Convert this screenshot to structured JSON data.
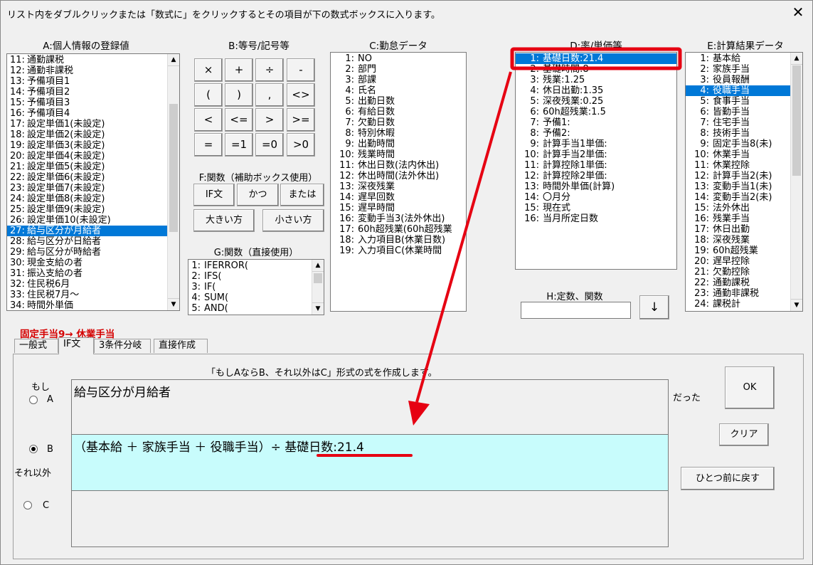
{
  "title": "リスト内をダブルクリックまたは「数式に」をクリックするとその項目が下の数式ボックスに入ります。",
  "close_glyph": "✕",
  "sections": {
    "a": "A:個人情報の登録値",
    "b": "B:等号/記号等",
    "c": "C:勤怠データ",
    "d": "D:率/単価等",
    "e": "E:計算結果データ",
    "f": "F:関数（補助ボックス使用）",
    "g": "G:関数（直接使用）",
    "h": "H:定数、関数"
  },
  "list_a": [
    {
      "n": "11:",
      "t": "通勤課税"
    },
    {
      "n": "12:",
      "t": "通勤非課税"
    },
    {
      "n": "13:",
      "t": "予備項目1"
    },
    {
      "n": "14:",
      "t": "予備項目2"
    },
    {
      "n": "15:",
      "t": "予備項目3"
    },
    {
      "n": "16:",
      "t": "予備項目4"
    },
    {
      "n": "17:",
      "t": "設定単価1(未設定)"
    },
    {
      "n": "18:",
      "t": "設定単価2(未設定)"
    },
    {
      "n": "19:",
      "t": "設定単価3(未設定)"
    },
    {
      "n": "20:",
      "t": "設定単価4(未設定)"
    },
    {
      "n": "21:",
      "t": "設定単価5(未設定)"
    },
    {
      "n": "22:",
      "t": "設定単価6(未設定)"
    },
    {
      "n": "23:",
      "t": "設定単価7(未設定)"
    },
    {
      "n": "24:",
      "t": "設定単価8(未設定)"
    },
    {
      "n": "25:",
      "t": "設定単価9(未設定)"
    },
    {
      "n": "26:",
      "t": "設定単価10(未設定)"
    },
    {
      "n": "27:",
      "t": "給与区分が月給者",
      "sel": true
    },
    {
      "n": "28:",
      "t": "給与区分が日給者"
    },
    {
      "n": "29:",
      "t": "給与区分が時給者"
    },
    {
      "n": "30:",
      "t": "現金支給の者"
    },
    {
      "n": "31:",
      "t": "振込支給の者"
    },
    {
      "n": "32:",
      "t": "住民税6月"
    },
    {
      "n": "33:",
      "t": "住民税7月～"
    },
    {
      "n": "34:",
      "t": "時間外単価"
    }
  ],
  "ops": [
    "×",
    "+",
    "÷",
    "-",
    "(",
    ")",
    ",",
    "<>",
    "<",
    "<=",
    ">",
    ">=",
    "=",
    "=1",
    "=0",
    ">0"
  ],
  "func_f": [
    "IF文",
    "かつ",
    "または",
    "大きい方",
    "小さい方"
  ],
  "list_g": [
    {
      "n": "1:",
      "t": "IFERROR("
    },
    {
      "n": "2:",
      "t": "IFS("
    },
    {
      "n": "3:",
      "t": "IF("
    },
    {
      "n": "4:",
      "t": "SUM("
    },
    {
      "n": "5:",
      "t": "AND("
    }
  ],
  "list_c": [
    {
      "n": "1:",
      "t": "NO"
    },
    {
      "n": "2:",
      "t": "部門"
    },
    {
      "n": "3:",
      "t": "部課"
    },
    {
      "n": "4:",
      "t": "氏名"
    },
    {
      "n": "5:",
      "t": "出勤日数"
    },
    {
      "n": "6:",
      "t": "有給日数"
    },
    {
      "n": "7:",
      "t": "欠勤日数"
    },
    {
      "n": "8:",
      "t": "特別休暇"
    },
    {
      "n": "9:",
      "t": "出勤時間"
    },
    {
      "n": "10:",
      "t": "残業時間"
    },
    {
      "n": "11:",
      "t": "休出日数(法内休出)"
    },
    {
      "n": "12:",
      "t": "休出時間(法外休出)"
    },
    {
      "n": "13:",
      "t": "深夜残業"
    },
    {
      "n": "14:",
      "t": "遅早回数"
    },
    {
      "n": "15:",
      "t": "遅早時間"
    },
    {
      "n": "16:",
      "t": "変動手当3(法外休出)"
    },
    {
      "n": "17:",
      "t": "60h超残業(60h超残業"
    },
    {
      "n": "18:",
      "t": "入力項目B(休業日数)"
    },
    {
      "n": "19:",
      "t": "入力項目C(休業時間"
    }
  ],
  "list_d": [
    {
      "n": "1:",
      "t": "基礎日数:21.4",
      "sel": true
    },
    {
      "n": "2:",
      "t": "基礎時間:8"
    },
    {
      "n": "3:",
      "t": "残業:1.25"
    },
    {
      "n": "4:",
      "t": "休日出勤:1.35"
    },
    {
      "n": "5:",
      "t": "深夜残業:0.25"
    },
    {
      "n": "6:",
      "t": "60h超残業:1.5"
    },
    {
      "n": "7:",
      "t": "予備1:"
    },
    {
      "n": "8:",
      "t": "予備2:"
    },
    {
      "n": "9:",
      "t": "計算手当1単価:"
    },
    {
      "n": "10:",
      "t": "計算手当2単価:"
    },
    {
      "n": "11:",
      "t": "計算控除1単価:"
    },
    {
      "n": "12:",
      "t": "計算控除2単価:"
    },
    {
      "n": "13:",
      "t": "時間外単価(計算)"
    },
    {
      "n": "14:",
      "t": "〇月分"
    },
    {
      "n": "15:",
      "t": "現在式"
    },
    {
      "n": "16:",
      "t": "当月所定日数"
    }
  ],
  "list_e": [
    {
      "n": "1:",
      "t": "基本給"
    },
    {
      "n": "2:",
      "t": "家族手当"
    },
    {
      "n": "3:",
      "t": "役員報酬"
    },
    {
      "n": "4:",
      "t": "役職手当",
      "sel": true
    },
    {
      "n": "5:",
      "t": "食事手当"
    },
    {
      "n": "6:",
      "t": "皆勤手当"
    },
    {
      "n": "7:",
      "t": "住宅手当"
    },
    {
      "n": "8:",
      "t": "技術手当"
    },
    {
      "n": "9:",
      "t": "固定手当8(未)"
    },
    {
      "n": "10:",
      "t": "休業手当"
    },
    {
      "n": "11:",
      "t": "休業控除"
    },
    {
      "n": "12:",
      "t": "計算手当2(未)"
    },
    {
      "n": "13:",
      "t": "変動手当1(未)"
    },
    {
      "n": "14:",
      "t": "変動手当2(未)"
    },
    {
      "n": "15:",
      "t": "法外休出"
    },
    {
      "n": "16:",
      "t": "残業手当"
    },
    {
      "n": "17:",
      "t": "休日出勤"
    },
    {
      "n": "18:",
      "t": "深夜残業"
    },
    {
      "n": "19:",
      "t": "60h超残業"
    },
    {
      "n": "20:",
      "t": "遅早控除"
    },
    {
      "n": "21:",
      "t": "欠勤控除"
    },
    {
      "n": "22:",
      "t": "通勤課税"
    },
    {
      "n": "23:",
      "t": "通勤非課税"
    },
    {
      "n": "24:",
      "t": "課税計"
    }
  ],
  "h_input_value": "",
  "down_arrow": "↓",
  "target_label": "固定手当9→ 休業手当",
  "tabs": [
    "一般式",
    "IF文",
    "3条件分岐",
    "直接作成"
  ],
  "active_tab": 1,
  "if_panel": {
    "instruction": "「もしAならB、それ以外はC」形式の式を作成します。",
    "label_moshi": "もし",
    "label_a": "A",
    "label_b": "B",
    "label_sore": "それ以外",
    "label_c": "C",
    "label_datta": "だった",
    "box_a": "給与区分が月給者",
    "box_b_prefix": "（基本給 ＋ 家族手当 ＋ 役職手当）÷ ",
    "box_b_highlight": "基礎日数:21.4",
    "box_c": "",
    "selected_radio": "B"
  },
  "buttons": {
    "ok": "OK",
    "clear": "クリア",
    "undo": "ひとつ前に戻す"
  },
  "colors": {
    "selection": "#0078d7",
    "annotation": "#e60012",
    "box_b_bg": "#c8fcfc",
    "target_label": "#d40000"
  }
}
